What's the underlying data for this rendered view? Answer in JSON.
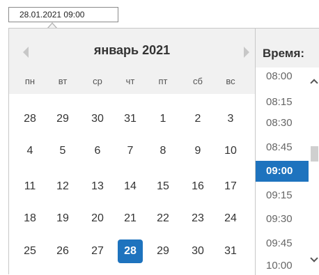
{
  "input": {
    "value": "28.01.2021 09:00"
  },
  "calendar": {
    "month_title": "январь 2021",
    "weekdays": [
      "пн",
      "вт",
      "ср",
      "чт",
      "пт",
      "сб",
      "вс"
    ],
    "weeks": [
      [
        "28",
        "29",
        "30",
        "31",
        "1",
        "2",
        "3"
      ],
      [
        "4",
        "5",
        "6",
        "7",
        "8",
        "9",
        "10"
      ],
      [
        "11",
        "12",
        "13",
        "14",
        "15",
        "16",
        "17"
      ],
      [
        "18",
        "19",
        "20",
        "21",
        "22",
        "23",
        "24"
      ],
      [
        "25",
        "26",
        "27",
        "28",
        "29",
        "30",
        "31"
      ]
    ],
    "selected_day": "28",
    "prev_icon": "chevron-left-icon",
    "next_icon": "chevron-right-icon"
  },
  "time": {
    "title": "Время:",
    "items": [
      "08:00",
      "08:15",
      "08:30",
      "08:45",
      "09:00",
      "09:15",
      "09:30",
      "09:45",
      "10:00"
    ],
    "selected": "09:00",
    "scroll_position": 0.39
  },
  "colors": {
    "accent": "#1e73be",
    "header_bg": "#f1f1f1",
    "border": "#c8c8c8"
  }
}
